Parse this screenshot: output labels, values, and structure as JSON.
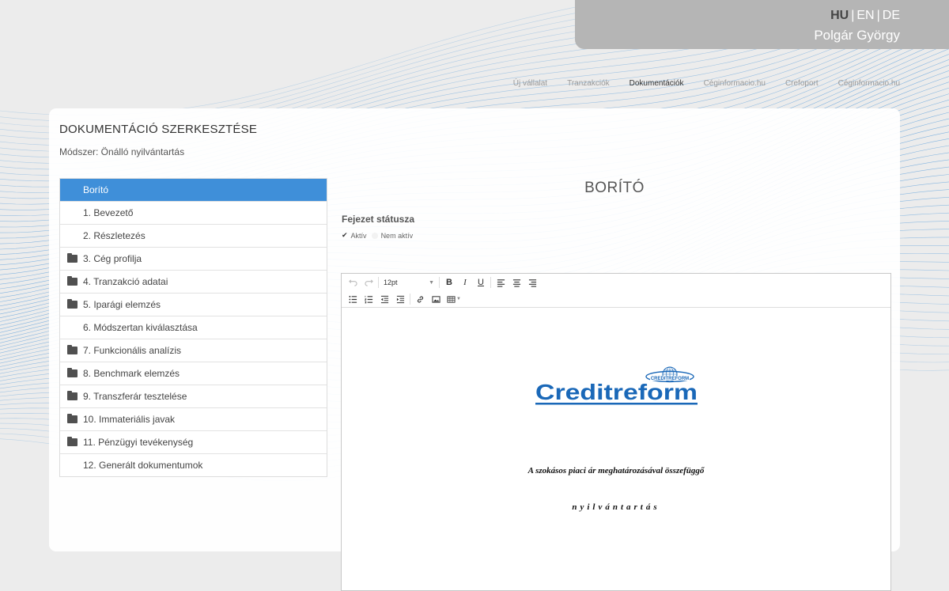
{
  "lang": {
    "options": [
      "HU",
      "EN",
      "DE"
    ],
    "active": "HU"
  },
  "user": {
    "name": "Polgár György"
  },
  "nav": {
    "items": [
      "Új vállalat",
      "Tranzakciók",
      "Dokumentációk",
      "Céginformacio.hu",
      "Crefoport",
      "Céginformacio.hu"
    ],
    "active": "Dokumentációk"
  },
  "page": {
    "title": "DOKUMENTÁCIÓ SZERKESZTÉSE",
    "method": "Módszer: Önálló nyilvántartás"
  },
  "menu": {
    "items": [
      {
        "label": "Borító",
        "folder": false,
        "active": true
      },
      {
        "label": "1. Bevezető",
        "folder": false,
        "active": false
      },
      {
        "label": "2. Részletezés",
        "folder": false,
        "active": false
      },
      {
        "label": "3. Cég profilja",
        "folder": true,
        "active": false
      },
      {
        "label": "4. Tranzakció adatai",
        "folder": true,
        "active": false
      },
      {
        "label": "5. Iparági elemzés",
        "folder": true,
        "active": false
      },
      {
        "label": "6. Módszertan kiválasztása",
        "folder": false,
        "active": false
      },
      {
        "label": "7. Funkcionális analízis",
        "folder": true,
        "active": false
      },
      {
        "label": "8. Benchmark elemzés",
        "folder": true,
        "active": false
      },
      {
        "label": "9. Transzferár tesztelése",
        "folder": true,
        "active": false
      },
      {
        "label": "10. Immateriális javak",
        "folder": true,
        "active": false
      },
      {
        "label": "11. Pénzügyi tevékenység",
        "folder": true,
        "active": false
      },
      {
        "label": "12. Generált dokumentumok",
        "folder": false,
        "active": false
      }
    ]
  },
  "section": {
    "title": "BORÍTÓ",
    "status_label": "Fejezet státusza",
    "status_options": [
      "Aktív",
      "Nem aktív"
    ],
    "status_selected": "Aktív"
  },
  "editor": {
    "font_size": "12pt",
    "logo_text": "Creditreform",
    "logo_ring_text": "CREDITREFORM",
    "line1": "A szokásos piaci ár meghatározásával összefüggő",
    "line2": "nyilvántartás"
  },
  "colors": {
    "accent": "#3f8fd9",
    "logo_blue": "#1a68b8",
    "wave": "#3c8fd8",
    "panel": "#b5b5b5"
  },
  "icons": {
    "undo": "undo-icon",
    "redo": "redo-icon",
    "bold": "bold-icon",
    "italic": "italic-icon",
    "underline": "underline-icon",
    "align_left": "align-left-icon",
    "align_center": "align-center-icon",
    "align_right": "align-right-icon",
    "bullet_list": "bullet-list-icon",
    "numbered_list": "numbered-list-icon",
    "outdent": "outdent-icon",
    "indent": "indent-icon",
    "link": "link-icon",
    "image": "image-icon",
    "table": "table-icon",
    "folder": "folder-icon"
  }
}
